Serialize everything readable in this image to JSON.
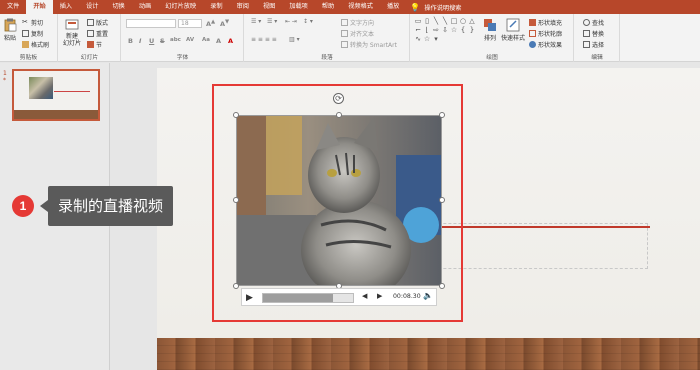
{
  "tabs": [
    "文件",
    "开始",
    "插入",
    "设计",
    "切换",
    "动画",
    "幻灯片放映",
    "录制",
    "审阅",
    "视图",
    "加载项",
    "帮助",
    "视频格式",
    "播放"
  ],
  "active_tab": "开始",
  "tell_me": "操作说明搜索",
  "ribbon": {
    "clipboard": {
      "paste": "粘贴",
      "cut": "剪切",
      "copy": "复制",
      "format_painter": "格式刷",
      "label": "剪贴板"
    },
    "slides": {
      "new_slide": "新建\n幻灯片",
      "layout": "版式",
      "reset": "重置",
      "section": "节",
      "label": "幻灯片"
    },
    "font": {
      "size": "18",
      "bold": "B",
      "italic": "I",
      "underline": "U",
      "strike": "S",
      "shadow": "abc",
      "spacing": "AV",
      "case": "Aa",
      "clear": "A",
      "color": "A",
      "label": "字体"
    },
    "paragraph": {
      "text_direction": "文字方向",
      "align_text": "对齐文本",
      "smartart": "转换为 SmartArt",
      "label": "段落"
    },
    "drawing": {
      "arrange": "排列",
      "quick_styles": "快速样式",
      "shape_fill": "形状填充",
      "shape_outline": "形状轮廓",
      "shape_effects": "形状效果",
      "label": "绘图"
    },
    "editing": {
      "find": "查找",
      "replace": "替换",
      "select": "选择",
      "label": "编辑"
    }
  },
  "thumbnail": {
    "number": "1",
    "star": "*"
  },
  "player": {
    "timecode": "00:08.30",
    "progress": 0.78
  },
  "callout": {
    "number": "1",
    "text": "录制的直播视频"
  },
  "colors": {
    "accent": "#b7472a",
    "highlight": "#e53935",
    "callout_bg": "#5a5a5a"
  }
}
